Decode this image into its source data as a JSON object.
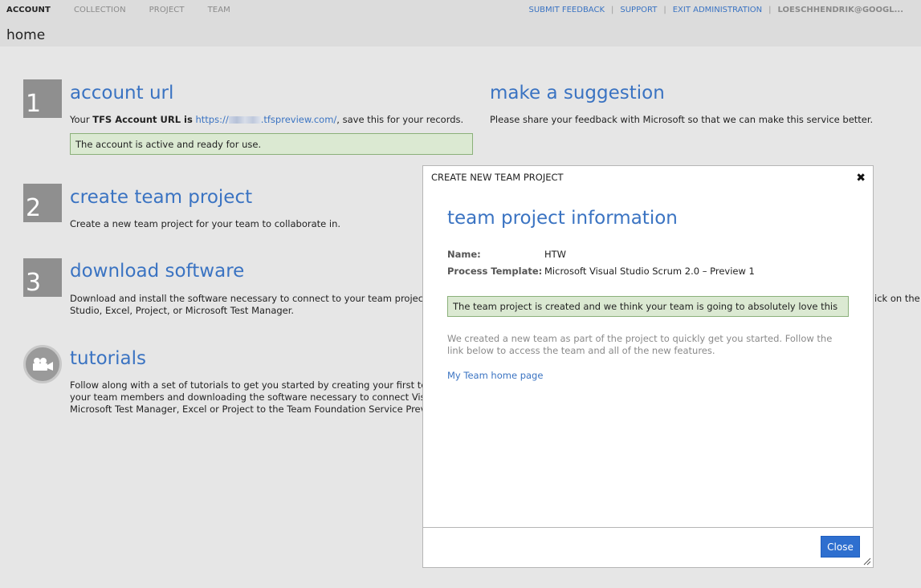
{
  "topnav": {
    "tabs": [
      "ACCOUNT",
      "COLLECTION",
      "PROJECT",
      "TEAM"
    ],
    "links": [
      "SUBMIT FEEDBACK",
      "SUPPORT",
      "EXIT ADMINISTRATION"
    ],
    "user": "LOESCHHENDRIK@GOOGL..."
  },
  "page_title": "home",
  "sections": {
    "account_url": {
      "number": "1",
      "title": "account url",
      "text_prefix": "Your ",
      "text_bold": "TFS Account URL is",
      "url_start": "https://",
      "url_end": ".tfspreview.com/",
      "text_suffix": ", save this for your records.",
      "notice": "The account is active and ready for use."
    },
    "suggestion": {
      "title": "make a suggestion",
      "text": "Please share your feedback with Microsoft so that we can make this service better."
    },
    "create_project": {
      "number": "2",
      "title": "create team project",
      "text": "Create a new team project for your team to collaborate in."
    },
    "download": {
      "number": "3",
      "title": "download software",
      "line1": "Download and install the software necessary to connect to your team project from V",
      "line2": "Studio, Excel, Project, or Microsoft Test Manager.",
      "right_fragment": "ick on the"
    },
    "tutorials": {
      "title": "tutorials",
      "line1": "Follow along with a set of tutorials to get you started by creating your first team pro",
      "line2": "your team members and downloading the software necessary to connect Visual Stu",
      "line3": "Microsoft Test Manager, Excel or Project to the Team Foundation Service Preview."
    }
  },
  "dialog": {
    "header": "CREATE NEW TEAM PROJECT",
    "close_x": "✖",
    "title": "team project information",
    "name_label": "Name:",
    "name_value": "HTW",
    "template_label": "Process Template:",
    "template_value": "Microsoft Visual Studio Scrum 2.0 – Preview 1",
    "success": "The team project is created and we think your team is going to absolutely love this",
    "info": "We created a new team as part of the project to quickly get you started. Follow the link below to access the team and all of the new features.",
    "team_link": "My Team home page",
    "close_button": "Close"
  },
  "colors": {
    "accent": "#3a73c2",
    "notice_bg": "#dbe9d2",
    "button": "#2e6fcf"
  },
  "icons": [
    "camera-icon",
    "close-icon",
    "resize-grip-icon"
  ]
}
